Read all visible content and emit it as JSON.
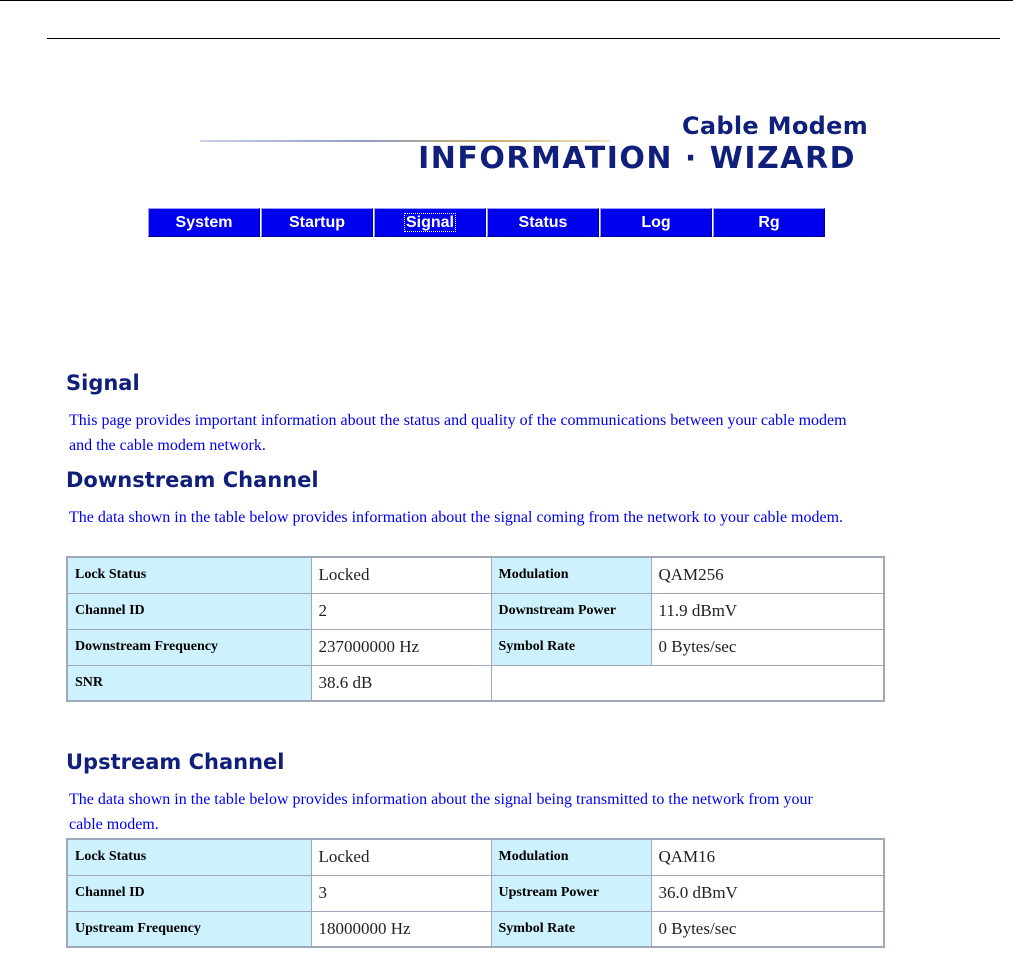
{
  "logo": {
    "subtitle": "Cable Modem",
    "title": "INFORMATION · WIZARD"
  },
  "nav": [
    "System",
    "Startup",
    "Signal",
    "Status",
    "Log",
    "Rg"
  ],
  "signal": {
    "heading": "Signal",
    "description": "This page provides important information about the status and quality of the communications between your cable modem and the cable modem network."
  },
  "downstream": {
    "heading": "Downstream Channel",
    "description": "The data shown in the table below provides information about the signal coming from the network to your cable modem.",
    "lock_status_label": "Lock Status",
    "lock_status": "Locked",
    "modulation_label": "Modulation",
    "modulation": "QAM256",
    "channel_id_label": "Channel ID",
    "channel_id": "2",
    "power_label": "Downstream Power",
    "power": "11.9 dBmV",
    "frequency_label": "Downstream Frequency",
    "frequency": "237000000 Hz",
    "symbol_rate_label": "Symbol Rate",
    "symbol_rate": "0 Bytes/sec",
    "snr_label": "SNR",
    "snr": "38.6 dB"
  },
  "upstream": {
    "heading": "Upstream Channel",
    "description": "The data shown in the table below provides information about the signal being transmitted to the network from your cable modem.",
    "lock_status_label": "Lock Status",
    "lock_status": "Locked",
    "modulation_label": "Modulation",
    "modulation": "QAM16",
    "channel_id_label": "Channel ID",
    "channel_id": "3",
    "power_label": "Upstream Power",
    "power": "36.0 dBmV",
    "frequency_label": "Upstream Frequency",
    "frequency": "18000000 Hz",
    "symbol_rate_label": "Symbol Rate",
    "symbol_rate": "0 Bytes/sec"
  }
}
